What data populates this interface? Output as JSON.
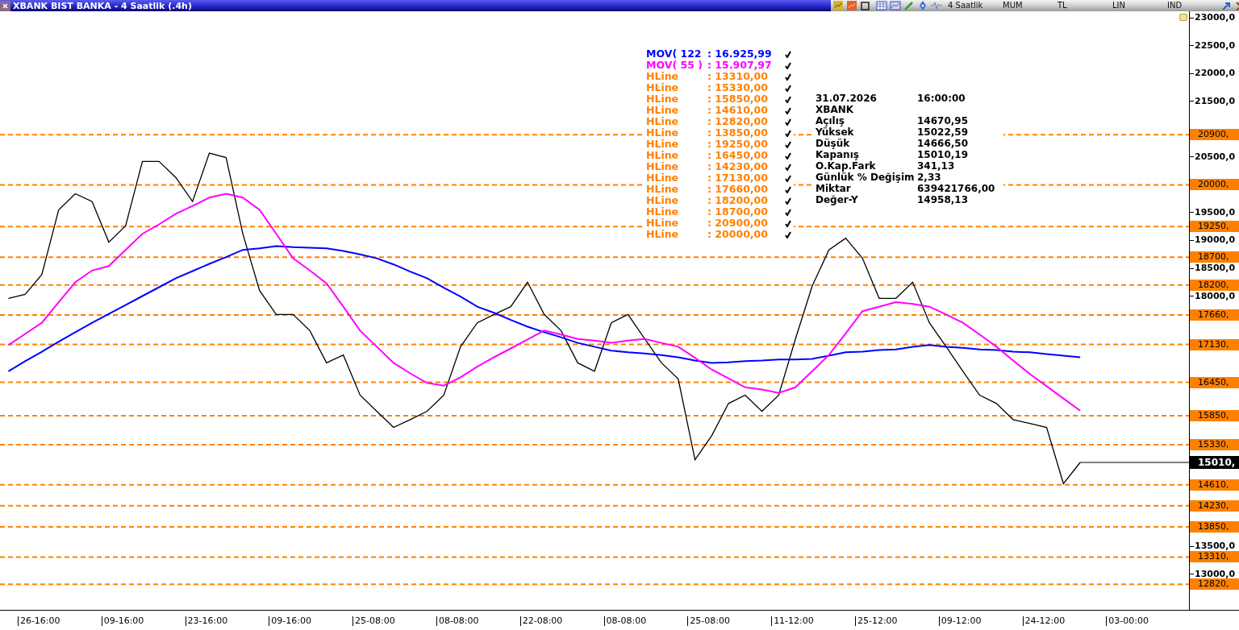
{
  "window": {
    "title": "XBANK BIST BANKA - 4 Saatlik (.4h)"
  },
  "toolbar": {
    "items": [
      "4 Saatlik",
      "MUM",
      "TL",
      "LIN",
      "IND"
    ]
  },
  "legend": [
    {
      "value": ": 16.925,99",
      "color": "#0000ff",
      "checked": true
    },
    {
      "value": ": 15.907,97",
      "color": "#ff00ff",
      "checked": true
    },
    {
      "name": "HLine",
      "value": ": 13310,00",
      "color": "#ff8000",
      "checked": true
    },
    {
      "name": "HLine",
      "value": ": 15330,00",
      "color": "#ff8000",
      "checked": true
    },
    {
      "name": "HLine",
      "value": ": 15850,00",
      "color": "#ff8000",
      "checked": true
    },
    {
      "name": "HLine",
      "value": ": 14610,00",
      "color": "#ff8000",
      "checked": true
    },
    {
      "name": "HLine",
      "value": ": 12820,00",
      "color": "#ff8000",
      "checked": true
    },
    {
      "name": "HLine",
      "value": ": 13850,00",
      "color": "#ff8000",
      "checked": true
    },
    {
      "name": "HLine",
      "value": ": 19250,00",
      "color": "#ff8000",
      "checked": true
    },
    {
      "name": "HLine",
      "value": ": 16450,00",
      "color": "#ff8000",
      "checked": true
    },
    {
      "name": "HLine",
      "value": ": 14230,00",
      "color": "#ff8000",
      "checked": true
    },
    {
      "name": "HLine",
      "value": ": 17130,00",
      "color": "#ff8000",
      "checked": true
    },
    {
      "name": "HLine",
      "value": ": 17660,00",
      "color": "#ff8000",
      "checked": true
    },
    {
      "name": "HLine",
      "value": ": 18200,00",
      "color": "#ff8000",
      "checked": true
    },
    {
      "name": "HLine",
      "value": ": 18700,00",
      "color": "#ff8000",
      "checked": true
    },
    {
      "name": "HLine",
      "value": ": 20900,00",
      "color": "#ff8000",
      "checked": true
    },
    {
      "name": "HLine",
      "value": ": 20000,00",
      "color": "#ff8000",
      "checked": true
    }
  ],
  "info": [
    {
      "label": "31.07.2026",
      "value": "16:00:00"
    },
    {
      "label": "XBANK"
    },
    {
      "label": "Açılış",
      "value": "14670,95"
    },
    {
      "label": "Yüksek",
      "value": "15022,59"
    },
    {
      "label": "Düşük",
      "value": "14666,50"
    },
    {
      "label": "Kapanış",
      "value": "15010,19"
    },
    {
      "label": "O.Kap.Fark",
      "value": "341,13"
    },
    {
      "label": "Günlük % Değişim",
      "value": "2,33"
    },
    {
      "label": "Miktar",
      "value": "639421766,00"
    },
    {
      "label": "Değer-Y",
      "value": "14958,13"
    }
  ],
  "chart_data": {
    "type": "line",
    "categories": [
      null,
      null,
      "26-16:00",
      null,
      null,
      null,
      null,
      "09-16:00",
      null,
      null,
      null,
      null,
      "23-16:00",
      null,
      null,
      null,
      null,
      "09-16:00",
      null,
      null,
      null,
      null,
      "25-08:00",
      null,
      null,
      null,
      null,
      "08-08:00",
      null,
      null,
      null,
      null,
      "22-08:00",
      null,
      null,
      null,
      null,
      "08-08:00",
      null,
      null,
      null,
      null,
      "25-08:00",
      null,
      null,
      null,
      null,
      "11-12:00",
      null,
      null,
      null,
      null,
      "25-12:00",
      null,
      null,
      null,
      null,
      "09-12:00",
      null,
      null,
      null,
      null,
      "24-12:00",
      null,
      null,
      null,
      null,
      "03-00:00",
      null,
      null,
      null
    ],
    "series": [
      {
        "color": "#000000",
        "values": [
          17960,
          18030,
          18390,
          19550,
          19840,
          19700,
          18970,
          19260,
          20420,
          20420,
          20130,
          19700,
          20570,
          20490,
          19120,
          18100,
          17670,
          17670,
          17380,
          16800,
          16940,
          16220,
          15930,
          15640,
          15780,
          15930,
          16220,
          17090,
          17520,
          17670,
          17810,
          18250,
          17670,
          17380,
          16800,
          16650,
          17520,
          17670,
          17230,
          16800,
          16510,
          15060,
          15490,
          16070,
          16220,
          15930,
          16220,
          17230,
          18180,
          18830,
          19040,
          18680,
          17960,
          17960,
          18250,
          17520,
          17090,
          16650,
          16220,
          16070,
          15780,
          15710,
          15640,
          14630,
          15010,
          null,
          null,
          null,
          null,
          null,
          null
        ]
      },
      {
        "name": "MOV( 122",
        "color": "#0000ff",
        "values": [
          16650,
          16830,
          17000,
          17180,
          17350,
          17520,
          17680,
          17840,
          18000,
          18160,
          18320,
          18450,
          18580,
          18700,
          18830,
          18860,
          18900,
          18880,
          18870,
          18860,
          18810,
          18750,
          18680,
          18570,
          18440,
          18320,
          18150,
          17990,
          17810,
          17700,
          17570,
          17450,
          17350,
          17260,
          17160,
          17090,
          17020,
          16990,
          16970,
          16940,
          16900,
          16840,
          16800,
          16810,
          16830,
          16840,
          16860,
          16860,
          16870,
          16930,
          16990,
          17000,
          17030,
          17040,
          17090,
          17120,
          17090,
          17070,
          17040,
          17030,
          17000,
          16990,
          16960,
          16930,
          16900,
          null,
          null,
          null,
          null,
          null,
          null
        ]
      },
      {
        "name": "MOV( 55 )",
        "color": "#ff00ff",
        "values": [
          17120,
          17320,
          17520,
          17890,
          18250,
          18460,
          18540,
          18830,
          19120,
          19290,
          19480,
          19620,
          19770,
          19840,
          19770,
          19550,
          19120,
          18680,
          18460,
          18230,
          17810,
          17380,
          17090,
          16800,
          16610,
          16440,
          16390,
          16540,
          16730,
          16900,
          17060,
          17220,
          17380,
          17310,
          17230,
          17200,
          17160,
          17200,
          17230,
          17160,
          17090,
          16890,
          16680,
          16520,
          16360,
          16320,
          16260,
          16360,
          16650,
          16940,
          17330,
          17730,
          17810,
          17890,
          17860,
          17810,
          17670,
          17520,
          17310,
          17090,
          16840,
          16600,
          16380,
          16160,
          15940,
          null,
          null,
          null,
          null,
          null,
          null
        ]
      }
    ],
    "ylim": [
      12360,
      23120
    ],
    "yticks": [
      {
        "value": 23000,
        "label": "23000,0"
      },
      {
        "value": 22500,
        "label": "22500,0"
      },
      {
        "value": 22000,
        "label": "22000,0"
      },
      {
        "value": 21500,
        "label": "21500,0"
      },
      {
        "value": 20500,
        "label": "20500,0"
      },
      {
        "value": 19500,
        "label": "19500,0"
      },
      {
        "value": 19000,
        "label": "19000,0"
      },
      {
        "value": 18500,
        "label": "18500,0"
      },
      {
        "value": 18000,
        "label": "18000,0"
      },
      {
        "value": 13500,
        "label": "13500,0"
      },
      {
        "value": 13000,
        "label": "13000,0"
      }
    ],
    "ref_lines": [
      {
        "axis": "y",
        "value": 13310,
        "label": "13310,",
        "color": "#ff8000"
      },
      {
        "axis": "y",
        "value": 15330,
        "label": "15330,",
        "color": "#ff8000"
      },
      {
        "axis": "y",
        "value": 15850,
        "label": "15850,",
        "color": "#ff8000"
      },
      {
        "axis": "y",
        "value": 14610,
        "label": "14610,",
        "color": "#ff8000"
      },
      {
        "axis": "y",
        "value": 12820,
        "label": "12820,",
        "color": "#ff8000"
      },
      {
        "axis": "y",
        "value": 13850,
        "label": "13850,",
        "color": "#ff8000"
      },
      {
        "axis": "y",
        "value": 19250,
        "label": "19250,",
        "color": "#ff8000"
      },
      {
        "axis": "y",
        "value": 16450,
        "label": "16450,",
        "color": "#ff8000"
      },
      {
        "axis": "y",
        "value": 14230,
        "label": "14230,",
        "color": "#ff8000"
      },
      {
        "axis": "y",
        "value": 17130,
        "label": "17130,",
        "color": "#ff8000"
      },
      {
        "axis": "y",
        "value": 17660,
        "label": "17660,",
        "color": "#ff8000"
      },
      {
        "axis": "y",
        "value": 18200,
        "label": "18200,",
        "color": "#ff8000"
      },
      {
        "axis": "y",
        "value": 18700,
        "label": "18700,",
        "color": "#ff8000"
      },
      {
        "axis": "y",
        "value": 20900,
        "label": "20900,",
        "color": "#ff8000"
      },
      {
        "axis": "y",
        "value": 20000,
        "label": "20000,",
        "color": "#ff8000"
      },
      {
        "axis": "y",
        "value": 15010,
        "label": "15010,",
        "color": "#000000"
      }
    ]
  }
}
